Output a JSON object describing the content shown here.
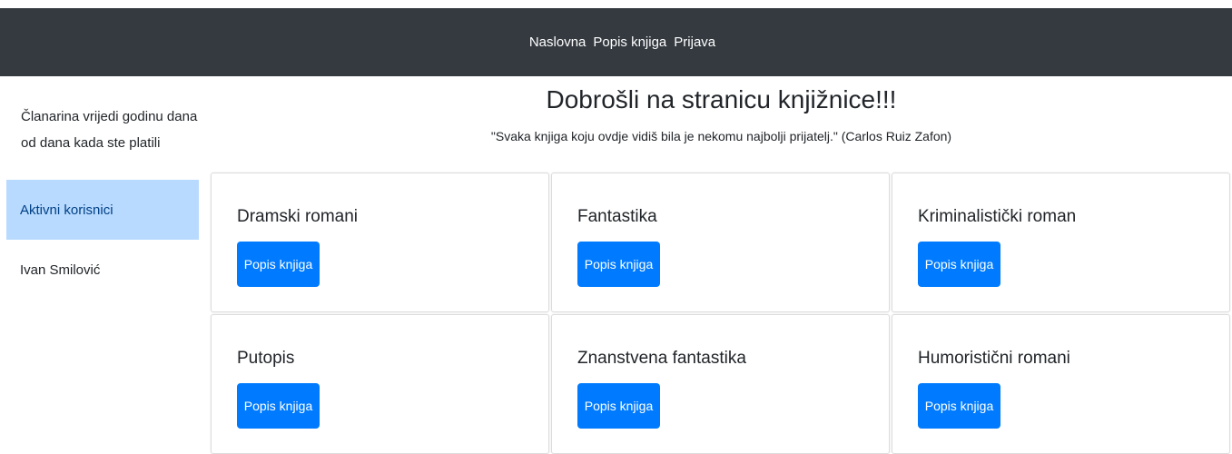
{
  "nav": {
    "items": [
      "Naslovna",
      "Popis knjiga",
      "Prijava"
    ]
  },
  "sidebar": {
    "note": "Članarina vrijedi godinu dana od dana kada ste platili",
    "items": [
      {
        "label": "Aktivni korisnici",
        "active": true
      },
      {
        "label": "Ivan Smilović",
        "active": false
      }
    ]
  },
  "main": {
    "title": "Dobrošli na stranicu knjižnice!!!",
    "quote": "\"Svaka knjiga koju ovdje vidiš bila je nekomu najbolji prijatelj.\" (Carlos Ruiz Zafon)"
  },
  "categories": [
    {
      "name": "Dramski romani",
      "button": "Popis knjiga"
    },
    {
      "name": "Fantastika",
      "button": "Popis knjiga"
    },
    {
      "name": "Kriminalistički roman",
      "button": "Popis knjiga"
    },
    {
      "name": "Putopis",
      "button": "Popis knjiga"
    },
    {
      "name": "Znanstvena fantastika",
      "button": "Popis knjiga"
    },
    {
      "name": "Humoristični romani",
      "button": "Popis knjiga"
    }
  ],
  "colors": {
    "navbar": "#343a40",
    "active_item": "#b8daff",
    "primary_button": "#007bff"
  }
}
